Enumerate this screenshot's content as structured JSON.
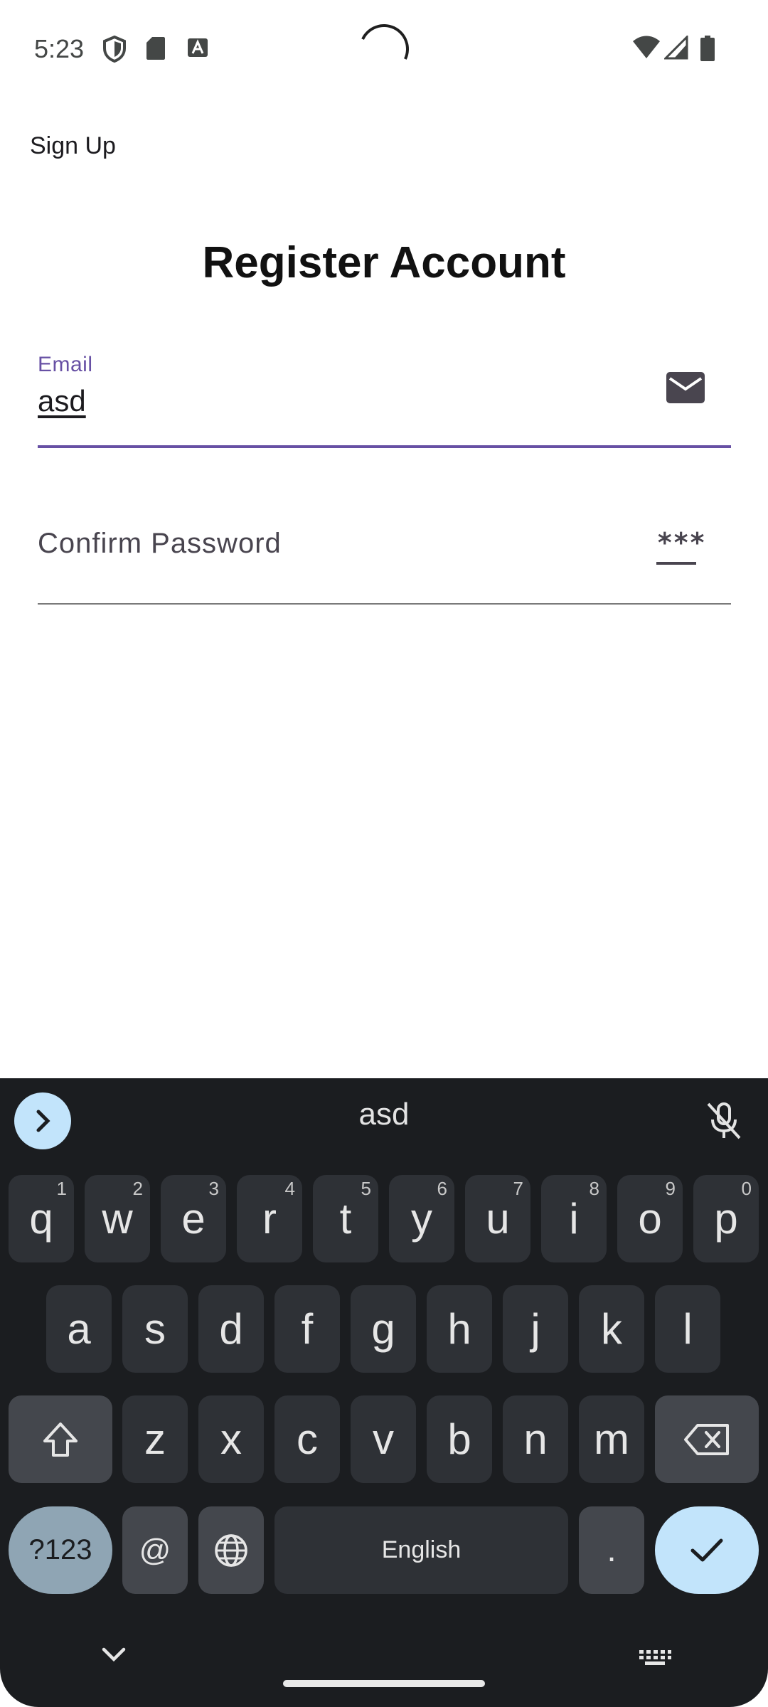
{
  "status_bar": {
    "time": "5:23",
    "icons": [
      "shield-icon",
      "sd-card-icon",
      "font-a-icon",
      "wifi-icon",
      "cell-signal-icon",
      "battery-icon"
    ]
  },
  "app_bar": {
    "title": "Sign Up"
  },
  "form": {
    "heading": "Register Account",
    "email": {
      "label": "Email",
      "value": "asd",
      "icon": "mail-icon"
    },
    "confirm_password": {
      "label": "Confirm Password",
      "icon_text": "***"
    }
  },
  "keyboard": {
    "suggestion": "asd",
    "row1": [
      {
        "key": "q",
        "hint": "1"
      },
      {
        "key": "w",
        "hint": "2"
      },
      {
        "key": "e",
        "hint": "3"
      },
      {
        "key": "r",
        "hint": "4"
      },
      {
        "key": "t",
        "hint": "5"
      },
      {
        "key": "y",
        "hint": "6"
      },
      {
        "key": "u",
        "hint": "7"
      },
      {
        "key": "i",
        "hint": "8"
      },
      {
        "key": "o",
        "hint": "9"
      },
      {
        "key": "p",
        "hint": "0"
      }
    ],
    "row2": [
      "a",
      "s",
      "d",
      "f",
      "g",
      "h",
      "j",
      "k",
      "l"
    ],
    "row3": [
      "z",
      "x",
      "c",
      "v",
      "b",
      "n",
      "m"
    ],
    "bottom": {
      "symbols": "?123",
      "at": "@",
      "space": "English",
      "period": "."
    }
  },
  "colors": {
    "accent": "#6750a4",
    "keyboard_bg": "#1b1d20",
    "key_bg": "#2e3136",
    "action_key": "#c2e4fb"
  }
}
